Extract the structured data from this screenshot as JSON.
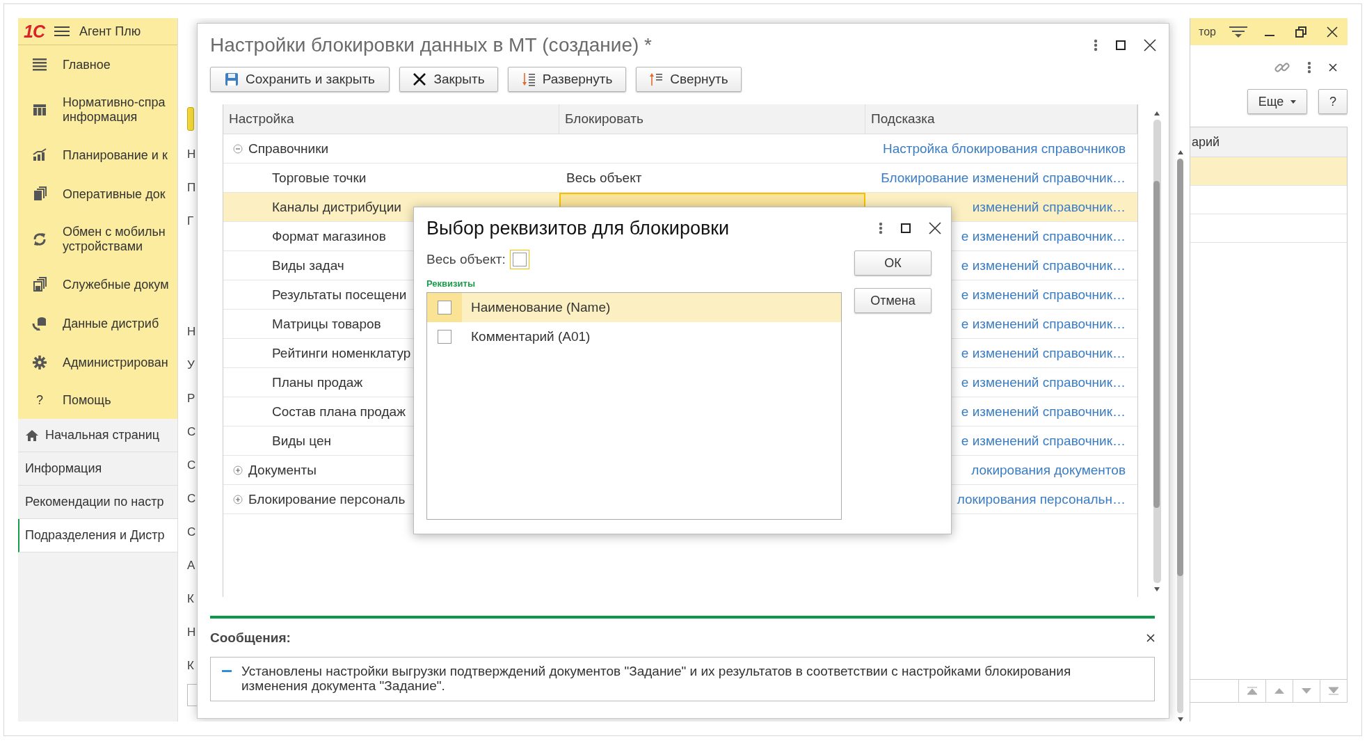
{
  "sidebar": {
    "logo": "1С",
    "app_title": "Агент Плю",
    "sections": [
      {
        "label": "Главное"
      },
      {
        "label": "Нормативно-спра\nинформация"
      },
      {
        "label": "Планирование и к"
      },
      {
        "label": "Оперативные док"
      },
      {
        "label": "Обмен с мобильн\nустройствами"
      },
      {
        "label": "Служебные докум"
      },
      {
        "label": "Данные дистриб"
      },
      {
        "label": "Администрирован"
      },
      {
        "label": "Помощь",
        "glyph": "?"
      }
    ],
    "nav": [
      {
        "label": "Начальная страниц",
        "selected": false
      },
      {
        "label": "Информация",
        "selected": false
      },
      {
        "label": "Рекомендации по настр",
        "selected": false
      },
      {
        "label": "Подразделения и Дистр",
        "selected": true
      }
    ]
  },
  "background_form": {
    "labels": [
      "Н",
      "П",
      "Г",
      "Н",
      "У",
      "Р",
      "С",
      "С",
      "С",
      "С",
      "А",
      "К",
      "Н",
      "К"
    ]
  },
  "right_form": {
    "header_text": "тор",
    "buttons": [
      "Еще",
      "?"
    ],
    "column_header": "арий",
    "rows": [
      {
        "selected": true
      },
      {
        "selected": false
      },
      {
        "selected": false
      }
    ]
  },
  "window": {
    "title": "Настройки блокировки данных в МТ (создание) *",
    "toolbar": [
      "Сохранить и закрыть",
      "Закрыть",
      "Развернуть",
      "Свернуть"
    ],
    "table": {
      "columns": [
        "Настройка",
        "Блокировать",
        "Подсказка"
      ],
      "rows": [
        {
          "name": "Справочники",
          "hint": "Настройка блокирования справочников",
          "expanded": true,
          "selected": false,
          "children": [
            {
              "name": "Торговые точки",
              "block": "Весь объект",
              "hint": "Блокирование изменений справочник…",
              "selected": false
            },
            {
              "name": "Каналы дистрибуции",
              "hint": "изменений справочник…",
              "selected": true
            },
            {
              "name": "Формат магазинов",
              "hint": "е изменений справочник…",
              "selected": false
            },
            {
              "name": "Виды задач",
              "hint": "е изменений справочник…",
              "selected": false
            },
            {
              "name": "Результаты посещени",
              "hint": "е изменений справочник…",
              "selected": false
            },
            {
              "name": "Матрицы товаров",
              "hint": "е изменений справочник…",
              "selected": false
            },
            {
              "name": "Рейтинги номенклатур",
              "hint": "е изменений справочник…",
              "selected": false
            },
            {
              "name": "Планы продаж",
              "hint": "е изменений справочник…",
              "selected": false
            },
            {
              "name": "Состав плана продаж",
              "hint": "е изменений справочник…",
              "selected": false
            },
            {
              "name": "Виды цен",
              "hint": "е изменений справочник…",
              "selected": false
            }
          ]
        },
        {
          "name": "Документы",
          "hint": "локирования документов",
          "expanded": false,
          "selected": false
        },
        {
          "name": "Блокирование персональ",
          "hint": "локирования персональн…",
          "expanded": false,
          "selected": false
        }
      ]
    },
    "messages": {
      "title": "Сообщения:",
      "items": [
        "Установлены настройки выгрузки подтверждений документов \"Задание\" и их результатов в соответствии с настройками блокирования изменения документа \"Задание\"."
      ]
    }
  },
  "dialog": {
    "title": "Выбор реквизитов для блокировки",
    "whole_object": {
      "label": "Весь объект:",
      "checked": false
    },
    "group_label": "Реквизиты",
    "items": [
      {
        "label": "Наименование (Name)",
        "checked": false,
        "selected": true
      },
      {
        "label": "Комментарий (A01)",
        "checked": false,
        "selected": false
      }
    ],
    "buttons": [
      "ОК",
      "Отмена"
    ]
  }
}
